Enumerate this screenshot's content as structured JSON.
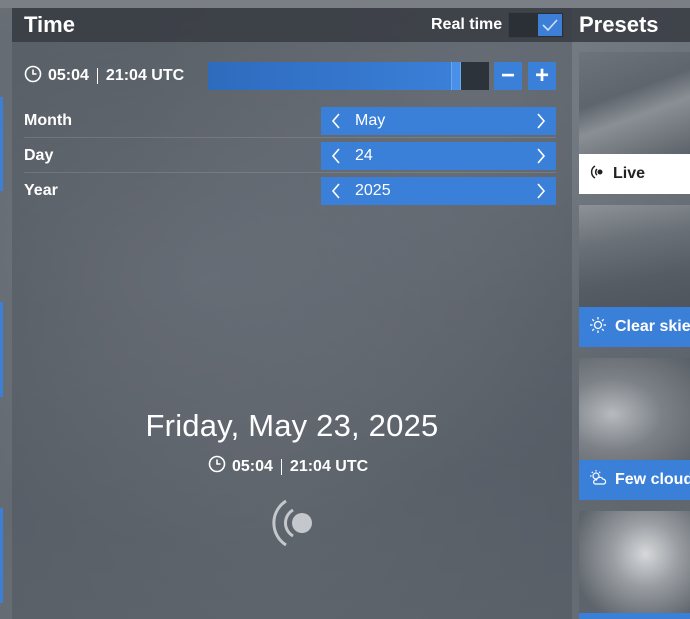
{
  "time_panel": {
    "title": "Time",
    "real_time_label": "Real time",
    "real_time_enabled": true,
    "local_time": "05:04",
    "utc_time": "21:04 UTC",
    "slider_position": 0.9,
    "decrement_label": "−",
    "increment_label": "+",
    "fields": [
      {
        "label": "Month",
        "value": "May"
      },
      {
        "label": "Day",
        "value": "24"
      },
      {
        "label": "Year",
        "value": "2025"
      }
    ],
    "full_date": "Friday, May 23, 2025",
    "footer_local_time": "05:04",
    "footer_utc_time": "21:04 UTC"
  },
  "presets_panel": {
    "title": "Presets",
    "items": [
      {
        "label": "Live",
        "icon": "live-icon",
        "selected": true
      },
      {
        "label": "Clear skie",
        "icon": "sun-icon",
        "selected": false
      },
      {
        "label": "Few cloud",
        "icon": "cloud-sun-icon",
        "selected": false
      }
    ]
  },
  "colors": {
    "accent": "#3b80d8",
    "panel_header": "#373b42",
    "selected_preset": "#ffffff"
  }
}
